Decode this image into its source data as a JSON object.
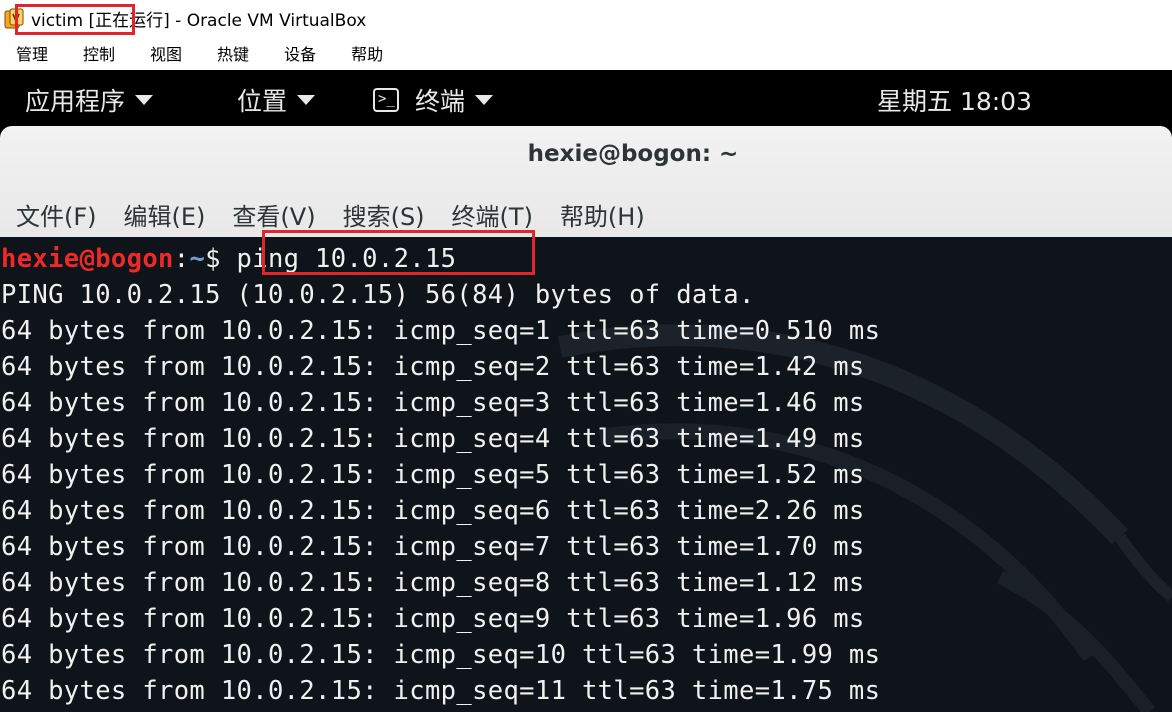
{
  "vbox": {
    "title": "victim [正在运行] - Oracle VM VirtualBox",
    "menu": [
      "管理",
      "控制",
      "视图",
      "热键",
      "设备",
      "帮助"
    ]
  },
  "topbar": {
    "applications": "应用程序",
    "places": "位置",
    "terminal": "终端",
    "clock": "星期五 18:03"
  },
  "terminal": {
    "title": "hexie@bogon: ~",
    "menu": [
      "文件(F)",
      "编辑(E)",
      "查看(V)",
      "搜索(S)",
      "终端(T)",
      "帮助(H)"
    ],
    "prompt_user": "hexie@bogon",
    "prompt_sep": ":",
    "prompt_path": "~",
    "prompt_symbol": "$ ",
    "command": "ping 10.0.2.15",
    "output": [
      "PING 10.0.2.15 (10.0.2.15) 56(84) bytes of data.",
      "64 bytes from 10.0.2.15: icmp_seq=1 ttl=63 time=0.510 ms",
      "64 bytes from 10.0.2.15: icmp_seq=2 ttl=63 time=1.42 ms",
      "64 bytes from 10.0.2.15: icmp_seq=3 ttl=63 time=1.46 ms",
      "64 bytes from 10.0.2.15: icmp_seq=4 ttl=63 time=1.49 ms",
      "64 bytes from 10.0.2.15: icmp_seq=5 ttl=63 time=1.52 ms",
      "64 bytes from 10.0.2.15: icmp_seq=6 ttl=63 time=2.26 ms",
      "64 bytes from 10.0.2.15: icmp_seq=7 ttl=63 time=1.70 ms",
      "64 bytes from 10.0.2.15: icmp_seq=8 ttl=63 time=1.12 ms",
      "64 bytes from 10.0.2.15: icmp_seq=9 ttl=63 time=1.96 ms",
      "64 bytes from 10.0.2.15: icmp_seq=10 ttl=63 time=1.99 ms",
      "64 bytes from 10.0.2.15: icmp_seq=11 ttl=63 time=1.75 ms"
    ]
  },
  "colors": {
    "highlight_box": "#e0262b",
    "prompt_user": "#ef2929",
    "prompt_path": "#729fcf",
    "terminal_bg": "#0e1419"
  }
}
